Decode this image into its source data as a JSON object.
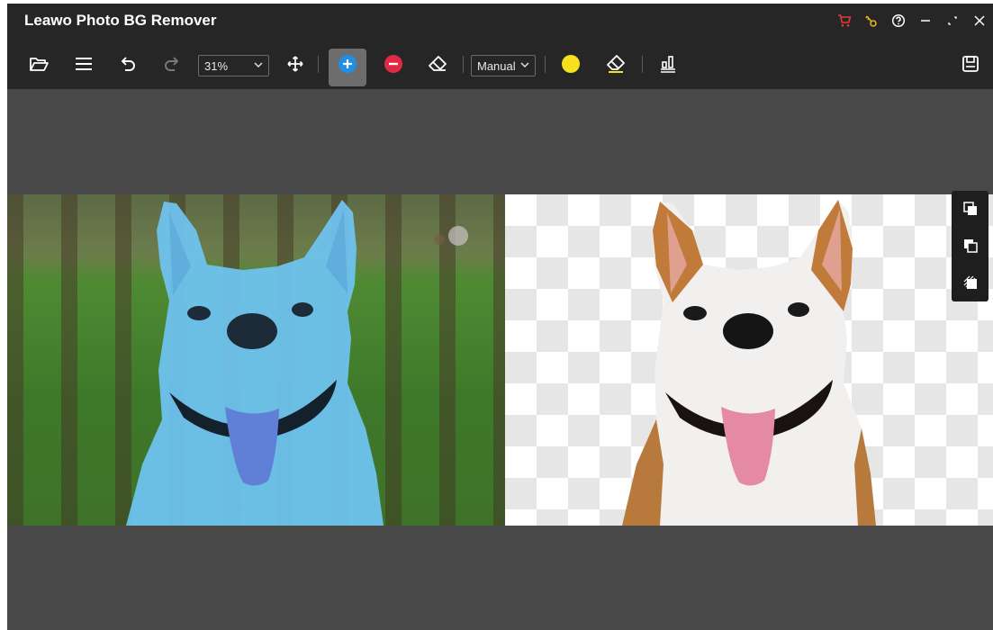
{
  "app": {
    "title": "Leawo Photo BG Remover"
  },
  "window_controls": [
    "cart-icon",
    "key-icon",
    "help-icon",
    "minimize-icon",
    "restore-icon",
    "close-icon"
  ],
  "toolbar": {
    "zoom": {
      "value": "31%"
    },
    "mode": {
      "value": "Manual"
    },
    "brush_color": "#f5e11d",
    "accent_add": "#1f8fe6",
    "accent_remove": "#e02a44"
  },
  "colors": {
    "titlebar": "#262626",
    "workspace": "#484848",
    "mask_overlay": "#6fc4f2"
  }
}
